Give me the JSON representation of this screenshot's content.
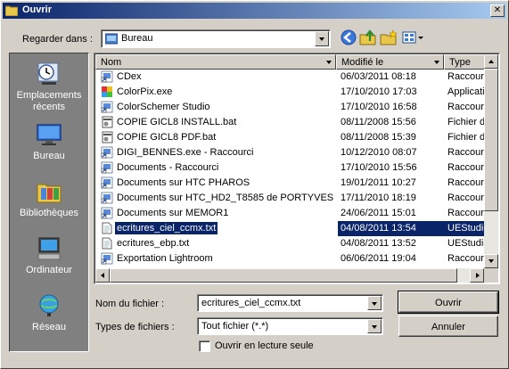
{
  "window": {
    "title": "Ouvrir"
  },
  "toolbar": {
    "look_in_label": "Regarder dans :",
    "look_in_value": "Bureau"
  },
  "places": [
    {
      "label": "Emplacements récents",
      "icon": "recent-places-icon"
    },
    {
      "label": "Bureau",
      "icon": "desktop-icon"
    },
    {
      "label": "Bibliothèques",
      "icon": "libraries-icon"
    },
    {
      "label": "Ordinateur",
      "icon": "computer-icon"
    },
    {
      "label": "Réseau",
      "icon": "network-icon"
    }
  ],
  "columns": {
    "name": "Nom",
    "date": "Modifié le",
    "type": "Type"
  },
  "files": [
    {
      "name": "CDex",
      "date": "06/03/2011 08:18",
      "type": "Raccourci",
      "icon": "shortcut-icon"
    },
    {
      "name": "ColorPix.exe",
      "date": "17/10/2010 17:03",
      "type": "Application",
      "icon": "app-icon"
    },
    {
      "name": "ColorSchemer Studio",
      "date": "17/10/2010 16:58",
      "type": "Raccourci",
      "icon": "shortcut-icon"
    },
    {
      "name": "COPIE GICL8  INSTALL.bat",
      "date": "08/11/2008 15:56",
      "type": "Fichier de",
      "icon": "bat-file-icon"
    },
    {
      "name": "COPIE GICL8 PDF.bat",
      "date": "08/11/2008 15:39",
      "type": "Fichier de",
      "icon": "bat-file-icon"
    },
    {
      "name": "DIGI_BENNES.exe - Raccourci",
      "date": "10/12/2010 08:07",
      "type": "Raccourci",
      "icon": "shortcut-icon"
    },
    {
      "name": "Documents - Raccourci",
      "date": "17/10/2010 15:56",
      "type": "Raccourci",
      "icon": "shortcut-icon"
    },
    {
      "name": "Documents sur HTC PHAROS",
      "date": "19/01/2011 10:27",
      "type": "Raccourci",
      "icon": "shortcut-icon"
    },
    {
      "name": "Documents sur HTC_HD2_T8585 de PORTYVES",
      "date": "17/11/2010 18:19",
      "type": "Raccourci",
      "icon": "shortcut-icon"
    },
    {
      "name": "Documents sur MEMOR1",
      "date": "24/06/2011 15:01",
      "type": "Raccourci",
      "icon": "shortcut-icon"
    },
    {
      "name": "ecritures_ciel_ccmx.txt",
      "date": "04/08/2011 13:54",
      "type": "UEStudio",
      "icon": "text-file-icon",
      "selected": true
    },
    {
      "name": "ecritures_ebp.txt",
      "date": "04/08/2011 13:52",
      "type": "UEStudio",
      "icon": "text-file-icon"
    },
    {
      "name": "Exportation Lightroom",
      "date": "06/06/2011 19:04",
      "type": "Raccourci",
      "icon": "shortcut-icon"
    }
  ],
  "form": {
    "filename_label": "Nom du fichier :",
    "filename_value": "ecritures_ciel_ccmx.txt",
    "filetype_label": "Types de fichiers :",
    "filetype_value": "Tout fichier (*.*)",
    "readonly_label": "Ouvrir en lecture seule",
    "open_button": "Ouvrir",
    "cancel_button": "Annuler"
  }
}
